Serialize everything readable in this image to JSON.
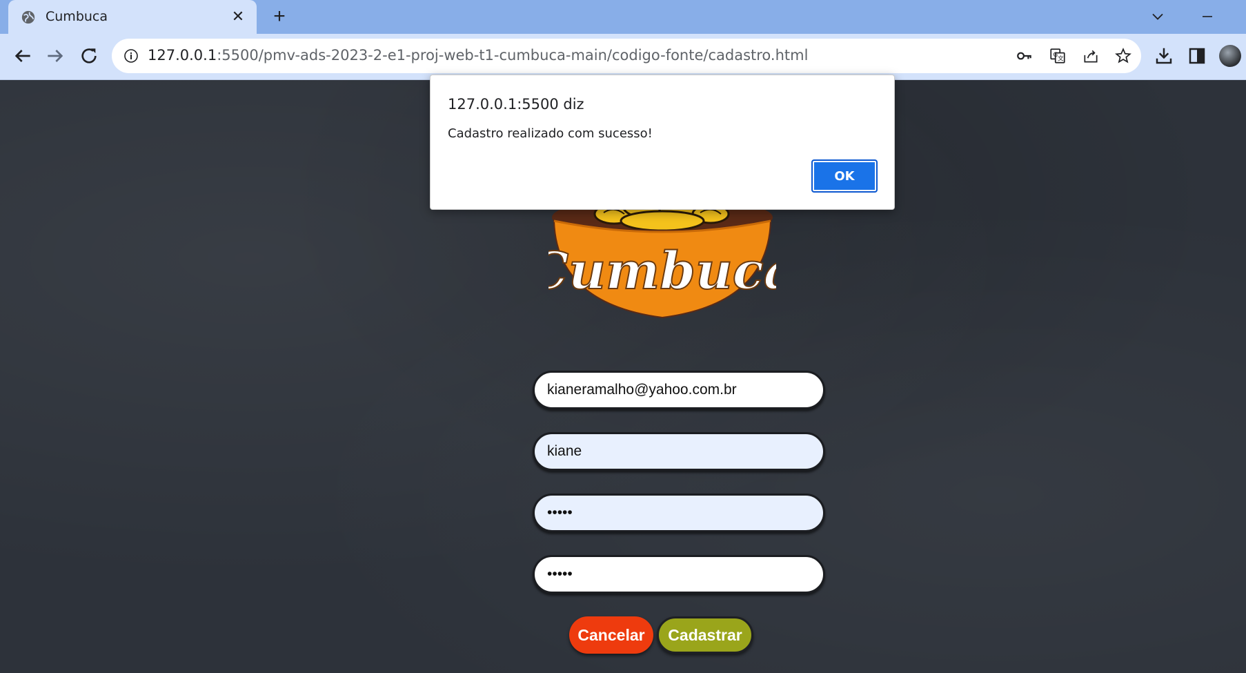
{
  "browser": {
    "tab": {
      "title": "Cumbuca",
      "favicon": "globe-icon"
    },
    "new_tab_label": "+",
    "url": {
      "host": "127.0.0.1",
      "rest": ":5500/pmv-ads-2023-2-e1-proj-web-t1-cumbuca-main/codigo-fonte/cadastro.html"
    }
  },
  "dialog": {
    "title": "127.0.0.1:5500 diz",
    "message": "Cadastro realizado com sucesso!",
    "ok_label": "OK"
  },
  "logo": {
    "text": "Cumbuca",
    "bowl_color": "#f08a12",
    "noodle_color": "#f4c21c"
  },
  "form": {
    "email_value": "kianeramalho@yahoo.com.br",
    "username_value": "kiane",
    "password_value": "•••••",
    "confirm_password_value": "•••••",
    "cancel_label": "Cancelar",
    "submit_label": "Cadastrar"
  },
  "colors": {
    "cancel_button": "#ee3b0e",
    "submit_button": "#9aa51b",
    "dialog_ok": "#1a73e8"
  }
}
